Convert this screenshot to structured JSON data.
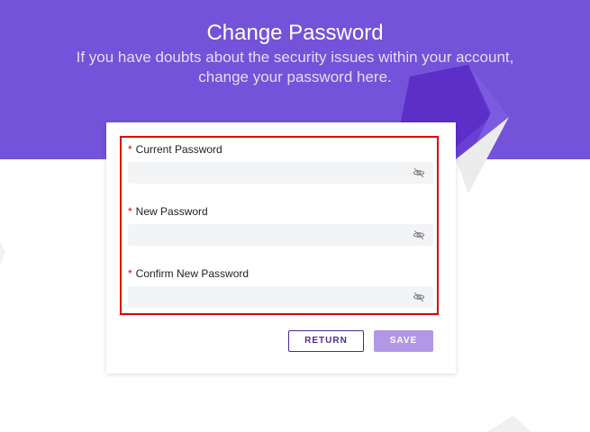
{
  "header": {
    "title": "Change Password",
    "subtitle_line1": "If you have doubts about the security issues within your account,",
    "subtitle_line2": "change your password here."
  },
  "form": {
    "fields": [
      {
        "required_mark": "*",
        "label": "Current Password",
        "value": "",
        "icon": "eye-slash-icon"
      },
      {
        "required_mark": "*",
        "label": "New Password",
        "value": "",
        "icon": "eye-slash-icon"
      },
      {
        "required_mark": "*",
        "label": "Confirm New Password",
        "value": "",
        "icon": "eye-slash-icon"
      }
    ]
  },
  "actions": {
    "return_label": "RETURN",
    "save_label": "SAVE"
  },
  "colors": {
    "banner": "#7452d9",
    "primary": "#4b2b91",
    "save_disabled": "#b197e6",
    "required": "#e00000",
    "highlight": "#e00000"
  }
}
